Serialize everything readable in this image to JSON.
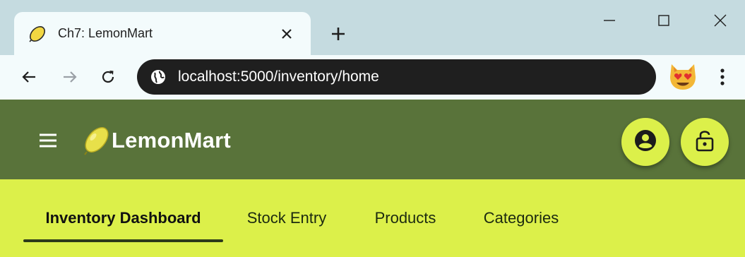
{
  "browser": {
    "tab_title": "Ch7: LemonMart",
    "url": "localhost:5000/inventory/home",
    "icons": {
      "favicon": "lemon-icon",
      "close": "close-icon",
      "new_tab": "plus-icon",
      "back": "arrow-left-icon",
      "forward": "arrow-right-icon",
      "reload": "reload-icon",
      "site_info": "globe-icon",
      "profile": "cat-heart-eyes-icon",
      "menu": "kebab-icon"
    }
  },
  "app": {
    "brand": "LemonMart",
    "colors": {
      "header": "#59733a",
      "tabs": "#dcf04a",
      "accent": "#dcf04a"
    },
    "icons": {
      "menu": "hamburger-icon",
      "logo": "lemon-icon",
      "account": "account-circle-icon",
      "login": "lock-open-icon"
    }
  },
  "nav": {
    "tabs": [
      {
        "label": "Inventory Dashboard",
        "active": true
      },
      {
        "label": "Stock Entry",
        "active": false
      },
      {
        "label": "Products",
        "active": false
      },
      {
        "label": "Categories",
        "active": false
      }
    ]
  }
}
